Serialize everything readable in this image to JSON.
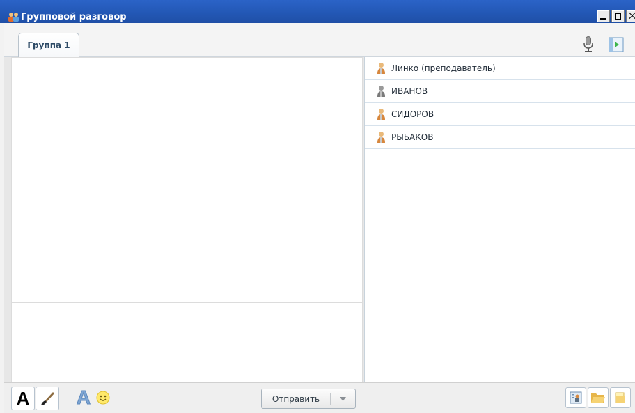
{
  "window": {
    "title": "Групповой разговор",
    "title_icon": "group-chat-icon",
    "controls": [
      "minimize-icon",
      "maximize-icon",
      "close-icon"
    ]
  },
  "tabs": [
    {
      "label": "Группа 1",
      "active": true
    }
  ],
  "tab_tools": {
    "mic_icon": "microphone-icon",
    "exit_icon": "exit-icon"
  },
  "participants": [
    {
      "name": "Линко (преподаватель)",
      "icon": "user-icon"
    },
    {
      "name": "ИВАНОВ",
      "icon": "user-icon"
    },
    {
      "name": "СИДОРОВ",
      "icon": "user-icon"
    },
    {
      "name": "РЫБАКОВ",
      "icon": "user-icon"
    }
  ],
  "toolbar": {
    "font_icon_glyph": "A",
    "text_style_icon_glyph": "A",
    "send_label": "Отправить",
    "tools": [
      "font-icon",
      "brush-icon",
      "text-style-icon",
      "smiley-icon"
    ],
    "right_tools": [
      "user-card-icon",
      "open-folder-icon",
      "folder-icon"
    ]
  },
  "colors": {
    "titlebar": "#2358b6",
    "tab_text": "#2d4a66",
    "row_divider": "#d7e2ec",
    "accent_green": "#3bb54a"
  }
}
